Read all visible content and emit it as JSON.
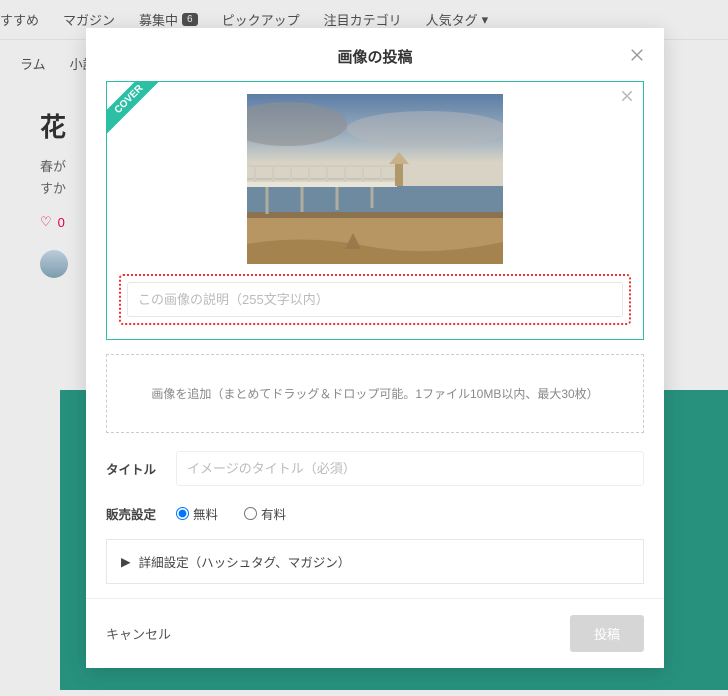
{
  "nav": {
    "items": [
      "すすめ",
      "マガジン",
      "募集中",
      "ピックアップ",
      "注目カテゴリ",
      "人気タグ"
    ],
    "badge": "6"
  },
  "subnav": {
    "items": [
      "ラム",
      "小説"
    ]
  },
  "article": {
    "title_prefix": "花",
    "lead_a": "春が",
    "lead_b": "すか",
    "likes": "0"
  },
  "modal": {
    "title": "画像の投稿",
    "cover_label": "COVER",
    "caption_placeholder": "この画像の説明（255文字以内）",
    "dropzone_text": "画像を追加（まとめてドラッグ＆ドロップ可能。1ファイル10MB以内、最大30枚）",
    "title_label": "タイトル",
    "title_placeholder": "イメージのタイトル（必須）",
    "sale_label": "販売設定",
    "sale_free": "無料",
    "sale_paid": "有料",
    "accordion": "詳細設定（ハッシュタグ、マガジン）",
    "cancel": "キャンセル",
    "submit": "投稿"
  }
}
